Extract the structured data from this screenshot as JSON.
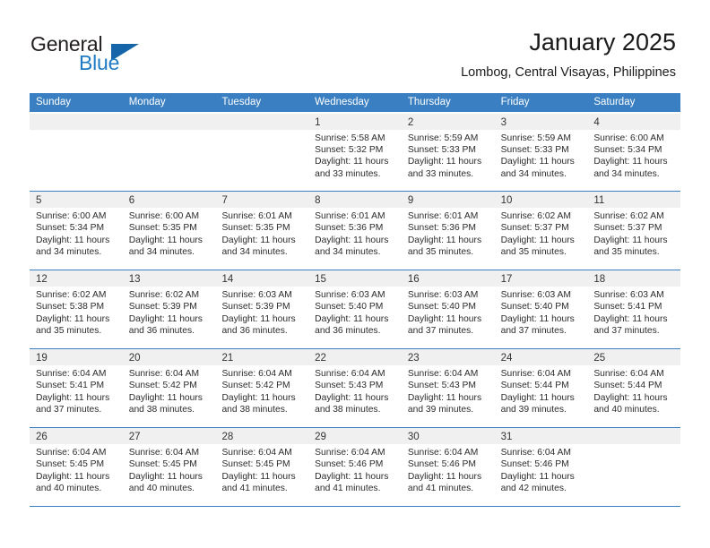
{
  "brand": {
    "word_one": "General",
    "word_two": "Blue",
    "triangle_icon": "triangle-icon",
    "accent_color": "#1f7ac4"
  },
  "header": {
    "title": "January 2025",
    "subtitle": "Lombog, Central Visayas, Philippines"
  },
  "theme": {
    "header_blue": "#3a7fc1",
    "day_strip_gray": "#f0f0f0",
    "text_color": "#2b2b2b"
  },
  "weekdays": [
    "Sunday",
    "Monday",
    "Tuesday",
    "Wednesday",
    "Thursday",
    "Friday",
    "Saturday"
  ],
  "weeks": [
    [
      {
        "day": "",
        "empty": true,
        "sunrise": "",
        "sunset": "",
        "daylight_line1": "",
        "daylight_line2": ""
      },
      {
        "day": "",
        "empty": true,
        "sunrise": "",
        "sunset": "",
        "daylight_line1": "",
        "daylight_line2": ""
      },
      {
        "day": "",
        "empty": true,
        "sunrise": "",
        "sunset": "",
        "daylight_line1": "",
        "daylight_line2": ""
      },
      {
        "day": "1",
        "empty": false,
        "sunrise": "Sunrise: 5:58 AM",
        "sunset": "Sunset: 5:32 PM",
        "daylight_line1": "Daylight: 11 hours",
        "daylight_line2": "and 33 minutes."
      },
      {
        "day": "2",
        "empty": false,
        "sunrise": "Sunrise: 5:59 AM",
        "sunset": "Sunset: 5:33 PM",
        "daylight_line1": "Daylight: 11 hours",
        "daylight_line2": "and 33 minutes."
      },
      {
        "day": "3",
        "empty": false,
        "sunrise": "Sunrise: 5:59 AM",
        "sunset": "Sunset: 5:33 PM",
        "daylight_line1": "Daylight: 11 hours",
        "daylight_line2": "and 34 minutes."
      },
      {
        "day": "4",
        "empty": false,
        "sunrise": "Sunrise: 6:00 AM",
        "sunset": "Sunset: 5:34 PM",
        "daylight_line1": "Daylight: 11 hours",
        "daylight_line2": "and 34 minutes."
      }
    ],
    [
      {
        "day": "5",
        "empty": false,
        "sunrise": "Sunrise: 6:00 AM",
        "sunset": "Sunset: 5:34 PM",
        "daylight_line1": "Daylight: 11 hours",
        "daylight_line2": "and 34 minutes."
      },
      {
        "day": "6",
        "empty": false,
        "sunrise": "Sunrise: 6:00 AM",
        "sunset": "Sunset: 5:35 PM",
        "daylight_line1": "Daylight: 11 hours",
        "daylight_line2": "and 34 minutes."
      },
      {
        "day": "7",
        "empty": false,
        "sunrise": "Sunrise: 6:01 AM",
        "sunset": "Sunset: 5:35 PM",
        "daylight_line1": "Daylight: 11 hours",
        "daylight_line2": "and 34 minutes."
      },
      {
        "day": "8",
        "empty": false,
        "sunrise": "Sunrise: 6:01 AM",
        "sunset": "Sunset: 5:36 PM",
        "daylight_line1": "Daylight: 11 hours",
        "daylight_line2": "and 34 minutes."
      },
      {
        "day": "9",
        "empty": false,
        "sunrise": "Sunrise: 6:01 AM",
        "sunset": "Sunset: 5:36 PM",
        "daylight_line1": "Daylight: 11 hours",
        "daylight_line2": "and 35 minutes."
      },
      {
        "day": "10",
        "empty": false,
        "sunrise": "Sunrise: 6:02 AM",
        "sunset": "Sunset: 5:37 PM",
        "daylight_line1": "Daylight: 11 hours",
        "daylight_line2": "and 35 minutes."
      },
      {
        "day": "11",
        "empty": false,
        "sunrise": "Sunrise: 6:02 AM",
        "sunset": "Sunset: 5:37 PM",
        "daylight_line1": "Daylight: 11 hours",
        "daylight_line2": "and 35 minutes."
      }
    ],
    [
      {
        "day": "12",
        "empty": false,
        "sunrise": "Sunrise: 6:02 AM",
        "sunset": "Sunset: 5:38 PM",
        "daylight_line1": "Daylight: 11 hours",
        "daylight_line2": "and 35 minutes."
      },
      {
        "day": "13",
        "empty": false,
        "sunrise": "Sunrise: 6:02 AM",
        "sunset": "Sunset: 5:39 PM",
        "daylight_line1": "Daylight: 11 hours",
        "daylight_line2": "and 36 minutes."
      },
      {
        "day": "14",
        "empty": false,
        "sunrise": "Sunrise: 6:03 AM",
        "sunset": "Sunset: 5:39 PM",
        "daylight_line1": "Daylight: 11 hours",
        "daylight_line2": "and 36 minutes."
      },
      {
        "day": "15",
        "empty": false,
        "sunrise": "Sunrise: 6:03 AM",
        "sunset": "Sunset: 5:40 PM",
        "daylight_line1": "Daylight: 11 hours",
        "daylight_line2": "and 36 minutes."
      },
      {
        "day": "16",
        "empty": false,
        "sunrise": "Sunrise: 6:03 AM",
        "sunset": "Sunset: 5:40 PM",
        "daylight_line1": "Daylight: 11 hours",
        "daylight_line2": "and 37 minutes."
      },
      {
        "day": "17",
        "empty": false,
        "sunrise": "Sunrise: 6:03 AM",
        "sunset": "Sunset: 5:40 PM",
        "daylight_line1": "Daylight: 11 hours",
        "daylight_line2": "and 37 minutes."
      },
      {
        "day": "18",
        "empty": false,
        "sunrise": "Sunrise: 6:03 AM",
        "sunset": "Sunset: 5:41 PM",
        "daylight_line1": "Daylight: 11 hours",
        "daylight_line2": "and 37 minutes."
      }
    ],
    [
      {
        "day": "19",
        "empty": false,
        "sunrise": "Sunrise: 6:04 AM",
        "sunset": "Sunset: 5:41 PM",
        "daylight_line1": "Daylight: 11 hours",
        "daylight_line2": "and 37 minutes."
      },
      {
        "day": "20",
        "empty": false,
        "sunrise": "Sunrise: 6:04 AM",
        "sunset": "Sunset: 5:42 PM",
        "daylight_line1": "Daylight: 11 hours",
        "daylight_line2": "and 38 minutes."
      },
      {
        "day": "21",
        "empty": false,
        "sunrise": "Sunrise: 6:04 AM",
        "sunset": "Sunset: 5:42 PM",
        "daylight_line1": "Daylight: 11 hours",
        "daylight_line2": "and 38 minutes."
      },
      {
        "day": "22",
        "empty": false,
        "sunrise": "Sunrise: 6:04 AM",
        "sunset": "Sunset: 5:43 PM",
        "daylight_line1": "Daylight: 11 hours",
        "daylight_line2": "and 38 minutes."
      },
      {
        "day": "23",
        "empty": false,
        "sunrise": "Sunrise: 6:04 AM",
        "sunset": "Sunset: 5:43 PM",
        "daylight_line1": "Daylight: 11 hours",
        "daylight_line2": "and 39 minutes."
      },
      {
        "day": "24",
        "empty": false,
        "sunrise": "Sunrise: 6:04 AM",
        "sunset": "Sunset: 5:44 PM",
        "daylight_line1": "Daylight: 11 hours",
        "daylight_line2": "and 39 minutes."
      },
      {
        "day": "25",
        "empty": false,
        "sunrise": "Sunrise: 6:04 AM",
        "sunset": "Sunset: 5:44 PM",
        "daylight_line1": "Daylight: 11 hours",
        "daylight_line2": "and 40 minutes."
      }
    ],
    [
      {
        "day": "26",
        "empty": false,
        "sunrise": "Sunrise: 6:04 AM",
        "sunset": "Sunset: 5:45 PM",
        "daylight_line1": "Daylight: 11 hours",
        "daylight_line2": "and 40 minutes."
      },
      {
        "day": "27",
        "empty": false,
        "sunrise": "Sunrise: 6:04 AM",
        "sunset": "Sunset: 5:45 PM",
        "daylight_line1": "Daylight: 11 hours",
        "daylight_line2": "and 40 minutes."
      },
      {
        "day": "28",
        "empty": false,
        "sunrise": "Sunrise: 6:04 AM",
        "sunset": "Sunset: 5:45 PM",
        "daylight_line1": "Daylight: 11 hours",
        "daylight_line2": "and 41 minutes."
      },
      {
        "day": "29",
        "empty": false,
        "sunrise": "Sunrise: 6:04 AM",
        "sunset": "Sunset: 5:46 PM",
        "daylight_line1": "Daylight: 11 hours",
        "daylight_line2": "and 41 minutes."
      },
      {
        "day": "30",
        "empty": false,
        "sunrise": "Sunrise: 6:04 AM",
        "sunset": "Sunset: 5:46 PM",
        "daylight_line1": "Daylight: 11 hours",
        "daylight_line2": "and 41 minutes."
      },
      {
        "day": "31",
        "empty": false,
        "sunrise": "Sunrise: 6:04 AM",
        "sunset": "Sunset: 5:46 PM",
        "daylight_line1": "Daylight: 11 hours",
        "daylight_line2": "and 42 minutes."
      },
      {
        "day": "",
        "empty": true,
        "sunrise": "",
        "sunset": "",
        "daylight_line1": "",
        "daylight_line2": ""
      }
    ]
  ]
}
